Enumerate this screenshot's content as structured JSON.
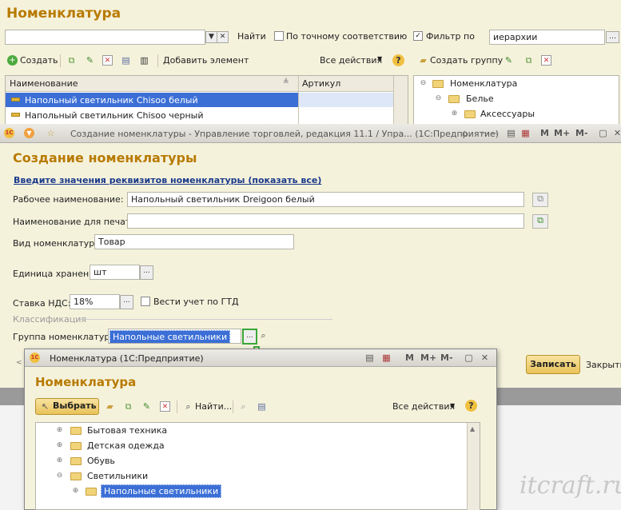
{
  "list": {
    "title": "Номенклатура",
    "find_label": "Найти",
    "exact_label": "По точному соответствию",
    "filter_label": "Фильтр по",
    "filter_value": "иерархии",
    "create_label": "Создать",
    "add_element_label": "Добавить элемент",
    "all_actions_label": "Все действия",
    "create_group_label": "Создать группу",
    "help_glyph": "?",
    "col_name": "Наименование",
    "col_article": "Артикул",
    "rows": [
      "Напольный светильник Chisoo белый",
      "Напольный светильник Chisoo черный"
    ],
    "tree": [
      "Номенклатура",
      "Белье",
      "Аксессуары"
    ]
  },
  "form": {
    "window_title": "Создание номенклатуры - Управление торговлей, редакция 11.1 / Упра... (1С:Предприятие)",
    "heading": "Создание номенклатуры",
    "hint_link": "Введите значения реквизитов номенклатуры (показать все)",
    "work_name_label": "Рабочее наименование:",
    "work_name_value": "Напольный светильник Dreigoon белый",
    "print_name_label": "Наименование для печати:",
    "print_name_value": "",
    "kind_label": "Вид номенклатуры:",
    "kind_value": "Товар",
    "unit_label": "Единица хранения:",
    "unit_value": "шт",
    "vat_label": "Ставка НДС:",
    "vat_value": "18%",
    "gtd_label": "Вести учет по ГТД",
    "classification_label": "Классификация",
    "group_label": "Группа номенклатуры:",
    "group_value": "Напольные светильники",
    "save_label": "Записать",
    "close_label": "Закрыть",
    "ellipsis": "...",
    "m_label": "M",
    "mplus_label": "M+",
    "mminus_label": "M-"
  },
  "picker": {
    "window_title": "Номенклатура  (1С:Предприятие)",
    "heading": "Номенклатура",
    "select_label": "Выбрать",
    "find_label": "Найти...",
    "all_actions_label": "Все действия",
    "items": [
      "Бытовая техника",
      "Детская одежда",
      "Обувь",
      "Светильники",
      "Напольные светильники"
    ]
  },
  "watermark": "itcraft.ru",
  "colors": {
    "accent": "#b87a00",
    "selected": "#3b6fd6",
    "green_marker": "#3aa63a"
  }
}
